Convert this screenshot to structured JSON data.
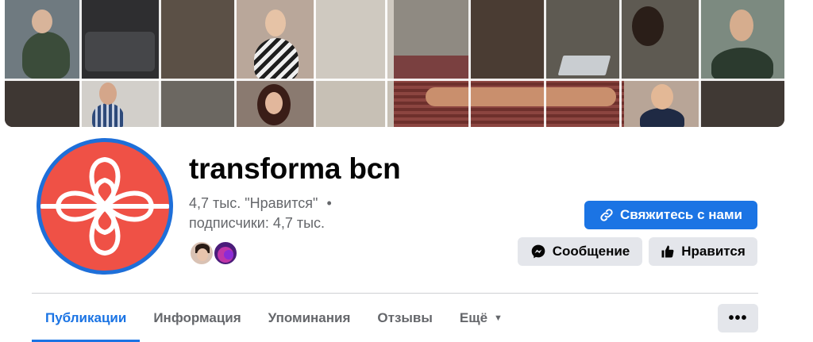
{
  "page": {
    "name": "transforma bcn",
    "likes_text": "4,7 тыс. \"Нравится\"",
    "separator": "•",
    "followers_text": "подписчики: 4,7 тыс."
  },
  "actions": {
    "contact_label": "Свяжитесь с нами",
    "message_label": "Сообщение",
    "like_label": "Нравится",
    "more_label": "•••"
  },
  "tabs": [
    {
      "label": "Публикации",
      "active": true
    },
    {
      "label": "Информация",
      "active": false
    },
    {
      "label": "Упоминания",
      "active": false
    },
    {
      "label": "Отзывы",
      "active": false
    },
    {
      "label": "Ещё",
      "active": false
    }
  ],
  "icons": {
    "contact": "link-icon",
    "message": "messenger-icon",
    "like": "thumbs-up-icon",
    "more_tab": "caret-down-icon"
  },
  "colors": {
    "accent": "#1b74e4",
    "logo_red": "#ef5146",
    "logo_ring": "#1e6fd9",
    "secondary_button": "#e4e6eb",
    "muted_text": "#65676b"
  }
}
